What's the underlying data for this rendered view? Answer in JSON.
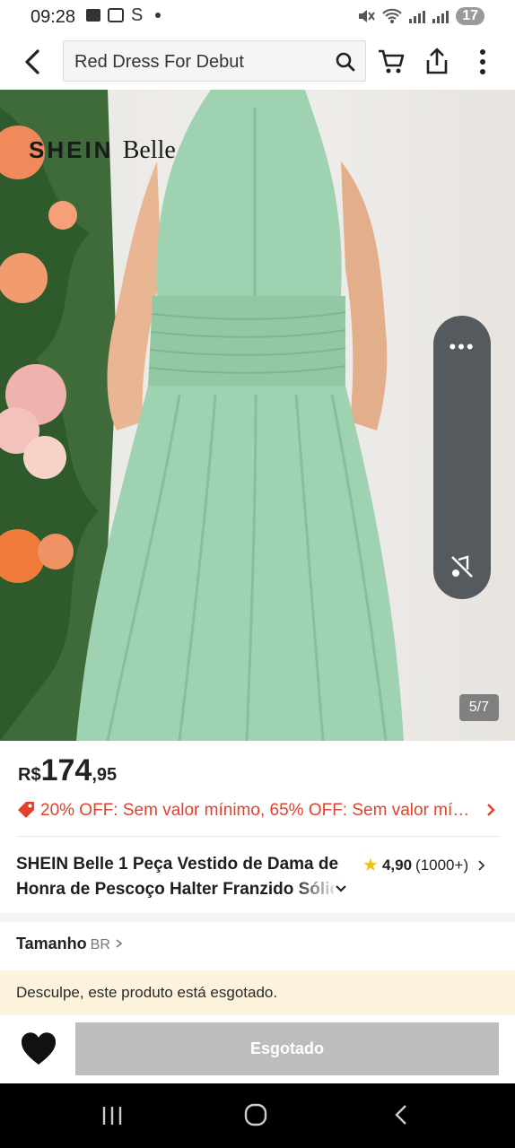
{
  "status_bar": {
    "time": "09:28",
    "battery": "17"
  },
  "search": {
    "query": "Red Dress For Debut"
  },
  "hero": {
    "brand_main": "SHEIN",
    "brand_sub": "Belle",
    "pager": "5/7",
    "more_glyph": "•••"
  },
  "price": {
    "currency": "R$",
    "integer": "174",
    "cents": ",95"
  },
  "promo": {
    "text": "20% OFF: Sem valor mínimo,  65% OFF: Sem valor míni..."
  },
  "product": {
    "title_line1": "SHEIN Belle 1 Peça Vestido de Dama de",
    "title_line2": "Honra de Pescoço Halter Franzido Sólido"
  },
  "rating": {
    "value": "4,90",
    "count": "(1000+)"
  },
  "size": {
    "label": "Tamanho",
    "region": "BR"
  },
  "soldout": {
    "message": "Desculpe, este produto está esgotado."
  },
  "actions": {
    "soldout_button": "Esgotado"
  },
  "colors": {
    "promo_red": "#e2402a",
    "star": "#f5c012",
    "dress_green": "#9fd2b0"
  }
}
